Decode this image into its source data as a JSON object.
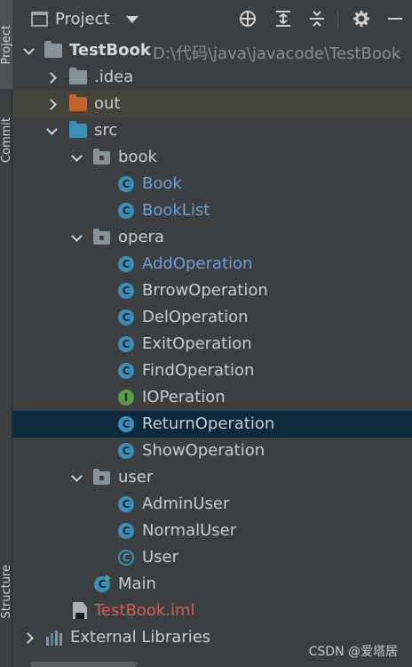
{
  "strip": {
    "tabs": [
      {
        "label": "Project",
        "active": true
      },
      {
        "label": "Commit",
        "active": false
      },
      {
        "label": "Structure",
        "active": false
      }
    ]
  },
  "header": {
    "title": "Project",
    "icons": [
      "locate-icon",
      "expand-all-icon",
      "collapse-all-icon",
      "settings-icon",
      "hide-icon"
    ]
  },
  "tree": {
    "root": {
      "name": "TestBook",
      "path": "D:\\代码\\java\\javacode\\TestBook"
    },
    "idea": ".idea",
    "out": "out",
    "src": "src",
    "book": "book",
    "book_items": [
      "Book",
      "BookList"
    ],
    "opera": "opera",
    "opera_items": [
      "AddOperation",
      "BrrowOperation",
      "DelOperation",
      "ExitOperation",
      "FindOperation",
      "IOPeration",
      "ReturnOperation",
      "ShowOperation"
    ],
    "user": "user",
    "user_items": [
      "AdminUser",
      "NormalUser",
      "User"
    ],
    "main": "Main",
    "iml": "TestBook.iml",
    "external": "External Libraries"
  },
  "class_letter": "C",
  "interface_letter": "I",
  "watermark": "CSDN @爱塔居",
  "colors": {
    "panel_bg": "#3c3f41",
    "selection_blue": "#0d293e",
    "selection_yellow": "#45443c",
    "modified_blue": "#6c9fd6",
    "unversioned_red": "#d65c53",
    "class_icon": "#3d8eb7",
    "interface_icon": "#5d9b47"
  }
}
